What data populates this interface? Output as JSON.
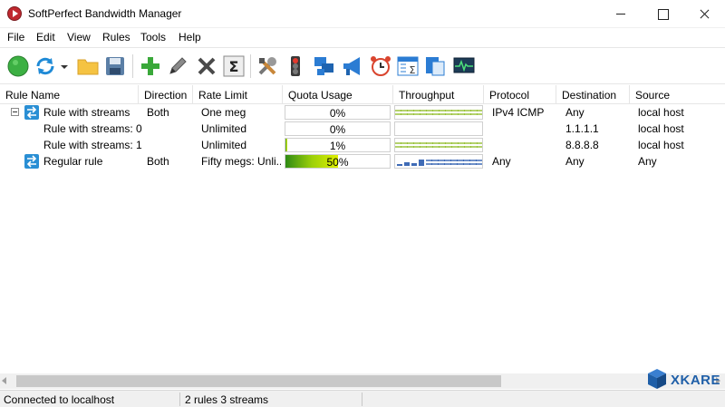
{
  "window": {
    "title": "SoftPerfect Bandwidth Manager"
  },
  "menu": [
    "File",
    "Edit",
    "View",
    "Rules",
    "Tools",
    "Help"
  ],
  "toolbar": {
    "buttons": [
      "start-icon",
      "refresh-icon",
      "open-folder-icon",
      "save-icon",
      "add-rule-icon",
      "edit-icon",
      "delete-icon",
      "sum-icon",
      "tools-icon",
      "traffic-light-icon",
      "network-icon",
      "announce-icon",
      "alarm-clock-icon",
      "calculator-icon",
      "copy-icon",
      "monitor-icon"
    ]
  },
  "columns": [
    "Rule Name",
    "Direction",
    "Rate Limit",
    "Quota Usage",
    "Throughput",
    "Protocol",
    "Destination",
    "Source"
  ],
  "rows": [
    {
      "name": "Rule with streams",
      "direction": "Both",
      "rate": "One meg",
      "quota": "0%",
      "quota_fraction": 0,
      "protocol": "IPv4 ICMP",
      "destination": "Any",
      "source": "local host"
    },
    {
      "name": "Rule with streams: 0",
      "direction": "",
      "rate": "Unlimited",
      "quota": "0%",
      "quota_fraction": 0,
      "protocol": "",
      "destination": "1.1.1.1",
      "source": "local host"
    },
    {
      "name": "Rule with streams: 1",
      "direction": "",
      "rate": "Unlimited",
      "quota": "1%",
      "quota_fraction": 0.01,
      "protocol": "",
      "destination": "8.8.8.8",
      "source": "local host"
    },
    {
      "name": "Regular rule",
      "direction": "Both",
      "rate": "Fifty megs: Unli...",
      "quota": "50%",
      "quota_fraction": 0.5,
      "protocol": "Any",
      "destination": "Any",
      "source": "Any"
    }
  ],
  "status": {
    "connection": "Connected to localhost",
    "summary": "2 rules 3 streams"
  },
  "watermark": {
    "text": "XKARE"
  },
  "colors": {
    "accent": "#2a8fd4",
    "quota_green": "#9cd00a",
    "throughput_green": "#9ac23c",
    "throughput_blue": "#3f6bb6"
  }
}
